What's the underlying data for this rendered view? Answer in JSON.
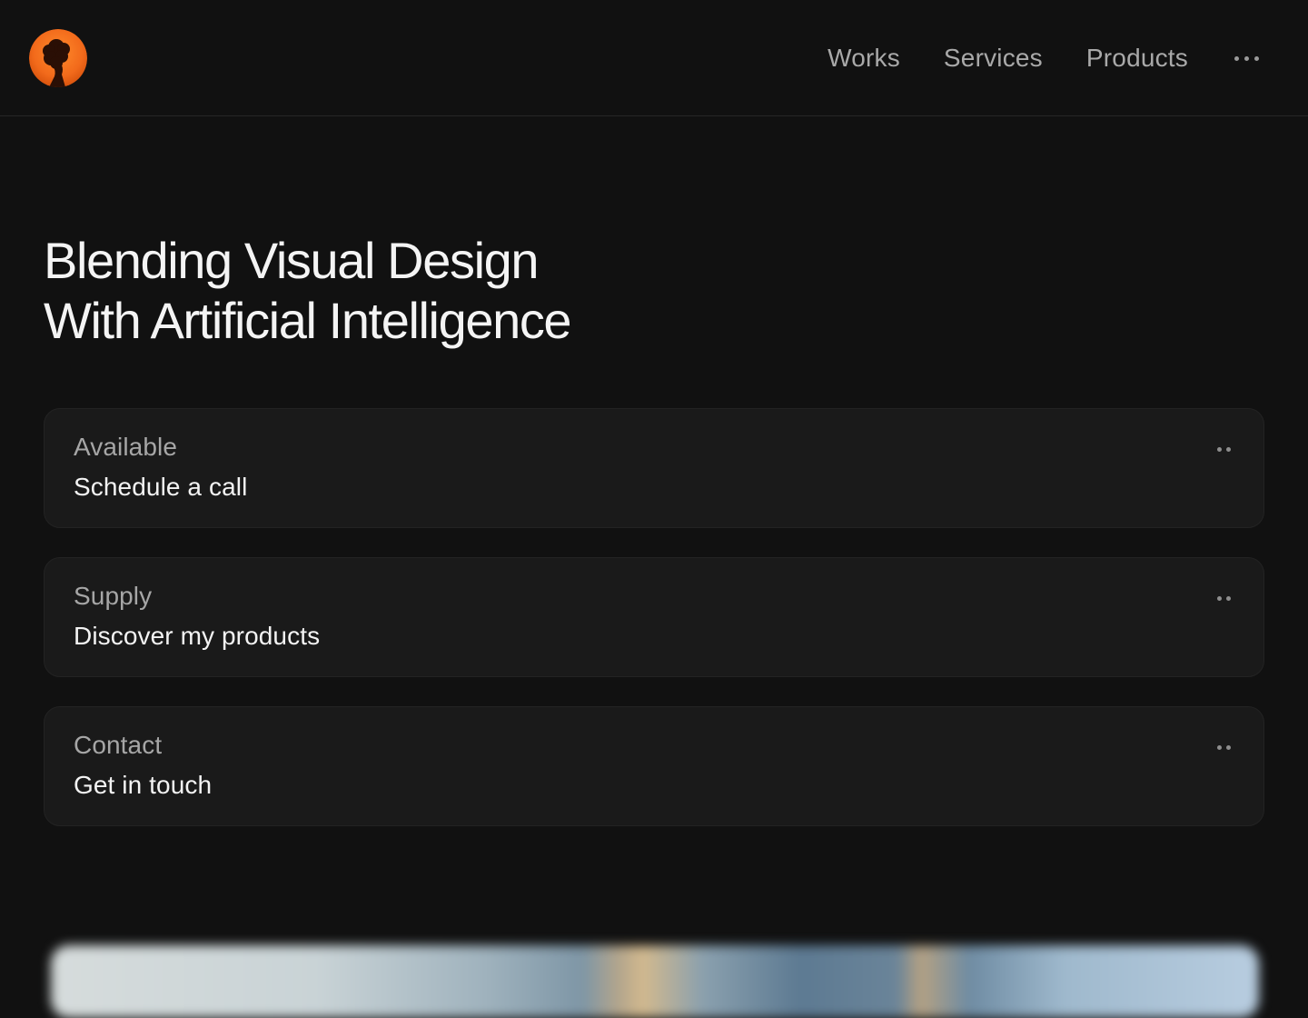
{
  "header": {
    "logo_alt": "",
    "nav": [
      {
        "label": "Works"
      },
      {
        "label": "Services"
      },
      {
        "label": "Products"
      }
    ],
    "more_icon": "ellipsis-icon"
  },
  "hero": {
    "title_line1": "Blending Visual Design",
    "title_line2": "With Artificial Intelligence"
  },
  "cards": [
    {
      "kicker": "Available",
      "label": "Schedule a call",
      "icon": "dots-icon"
    },
    {
      "kicker": "Supply",
      "label": "Discover my products",
      "icon": "dots-icon"
    },
    {
      "kicker": "Contact",
      "label": "Get in touch",
      "icon": "dots-icon"
    }
  ],
  "colors": {
    "background": "#111111",
    "card": "#1a1a1a",
    "accent_orange": "#f26a1b",
    "text_primary": "#f2f2f2",
    "text_muted": "#a9a9a9"
  }
}
